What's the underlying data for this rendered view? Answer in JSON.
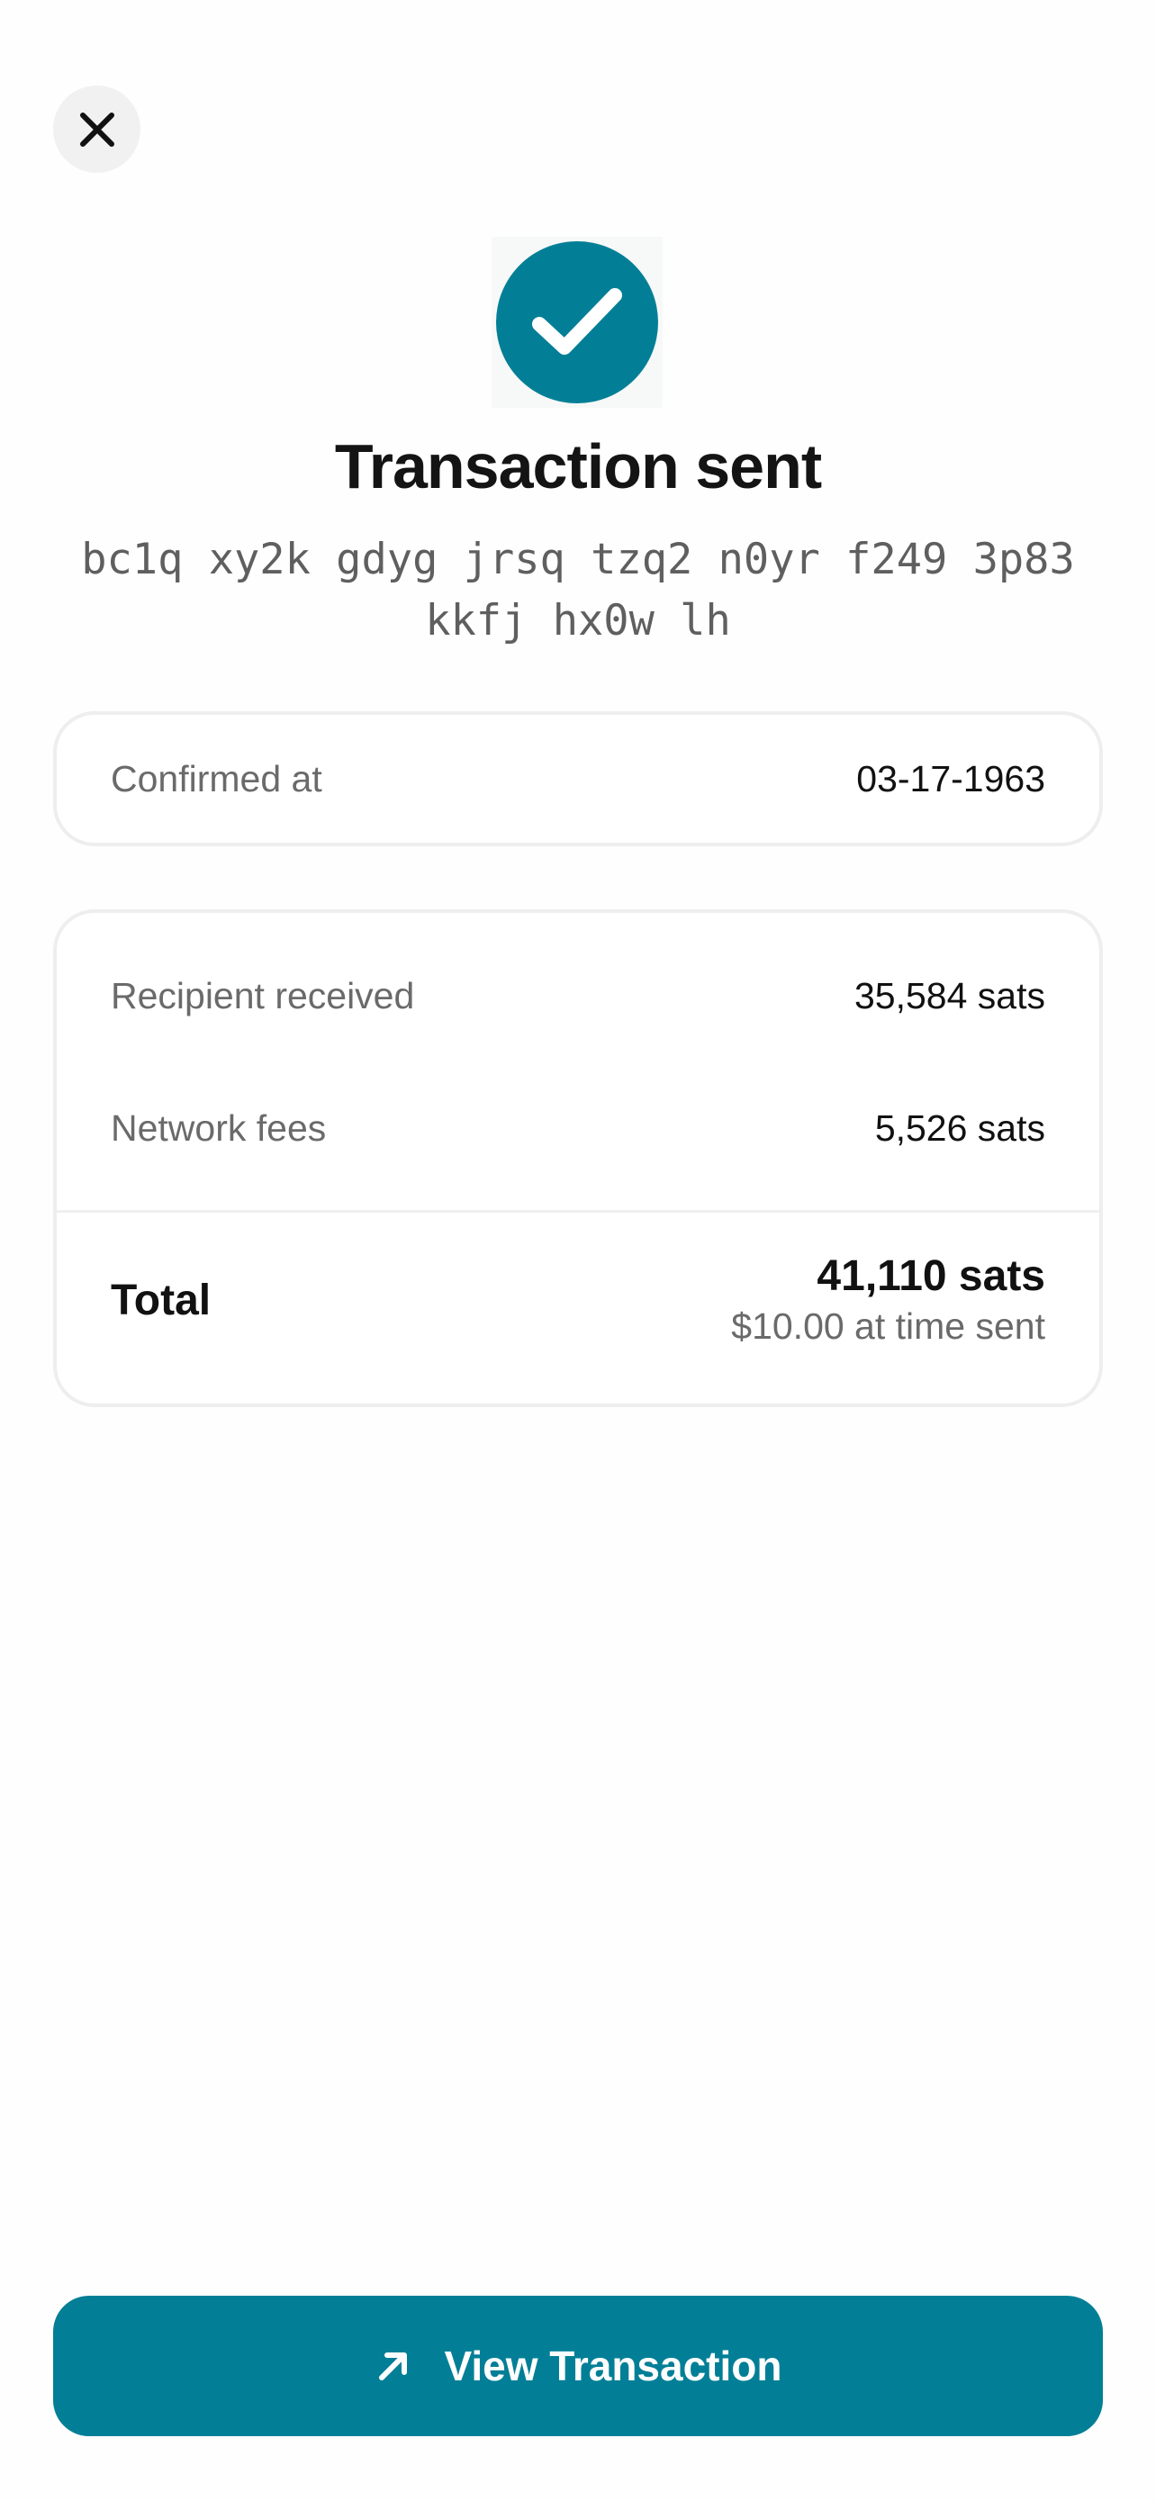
{
  "colors": {
    "accent": "#027f96",
    "close_bg": "#f1f1f1",
    "muted_text": "#6a6a6a"
  },
  "header": {
    "close_icon": "close-icon"
  },
  "status": {
    "icon": "checkmark-icon",
    "title": "Transaction sent",
    "address_line1": "bc1q xy2k gdyg jrsq tzq2 n0yr f249 3p83",
    "address_line2": "kkfj hx0w lh"
  },
  "confirmation": {
    "label": "Confirmed at",
    "value": "03-17-1963"
  },
  "amounts": {
    "recipient_label": "Recipient received",
    "recipient_value": "35,584 sats",
    "fees_label": "Network fees",
    "fees_value": "5,526 sats",
    "total_label": "Total",
    "total_value": "41,110 sats",
    "total_fiat": "$10.00 at time sent"
  },
  "footer": {
    "button_icon": "arrow-up-right-icon",
    "button_label": "View Transaction"
  }
}
